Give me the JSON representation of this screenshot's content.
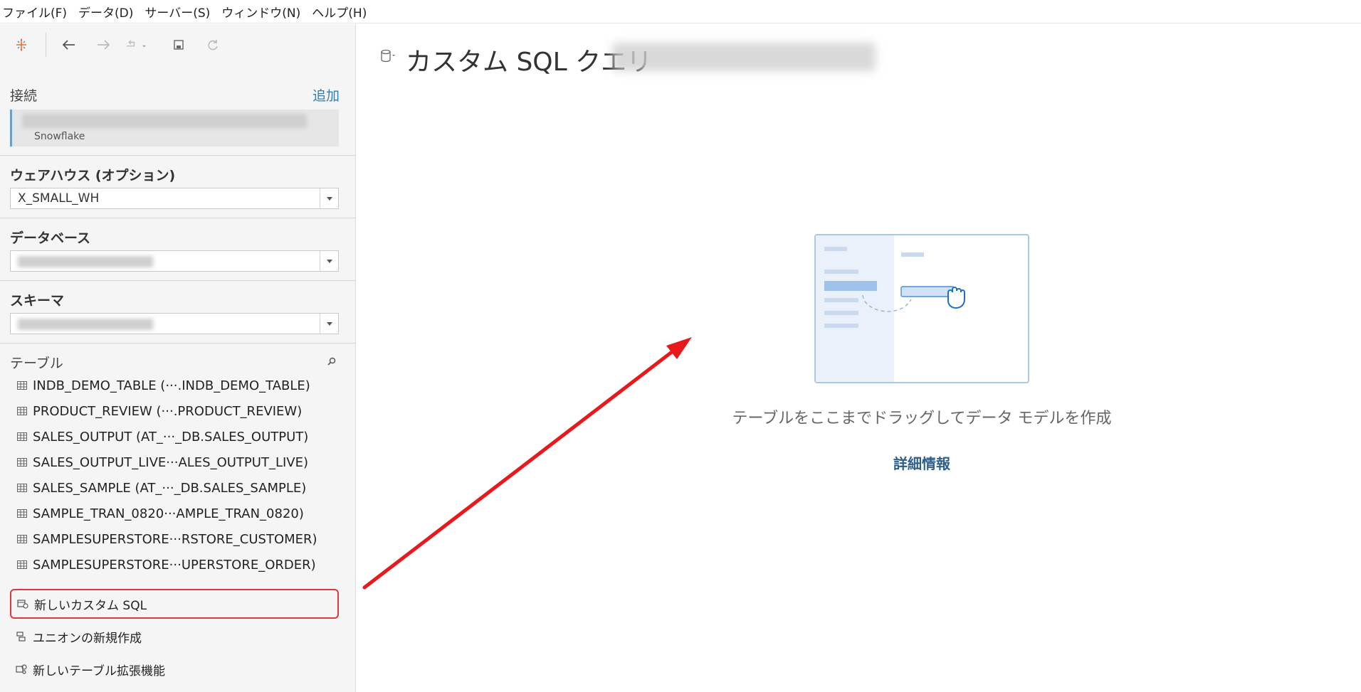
{
  "menu": {
    "file": "ファイル(F)",
    "data": "データ(D)",
    "server": "サーバー(S)",
    "window": "ウィンドウ(N)",
    "help": "ヘルプ(H)"
  },
  "sidebar": {
    "connections_label": "接続",
    "add_label": "追加",
    "connection_type": "Snowflake",
    "warehouse_label": "ウェアハウス (オプション)",
    "warehouse_value": "X_SMALL_WH",
    "database_label": "データベース",
    "schema_label": "スキーマ",
    "tables_label": "テーブル",
    "tables": [
      "INDB_DEMO_TABLE (···.INDB_DEMO_TABLE)",
      "PRODUCT_REVIEW (···.PRODUCT_REVIEW)",
      "SALES_OUTPUT (AT_···_DB.SALES_OUTPUT)",
      "SALES_OUTPUT_LIVE···ALES_OUTPUT_LIVE)",
      "SALES_SAMPLE (AT_···_DB.SALES_SAMPLE)",
      "SAMPLE_TRAN_0820···AMPLE_TRAN_0820)",
      "SAMPLESUPERSTORE···RSTORE_CUSTOMER)",
      "SAMPLESUPERSTORE···UPERSTORE_ORDER)"
    ],
    "new_custom_sql": "新しいカスタム SQL",
    "new_union": "ユニオンの新規作成",
    "new_table_extension": "新しいテーブル拡張機能"
  },
  "canvas": {
    "title": "カスタム SQL クエリ",
    "drop_message": "テーブルをここまでドラッグしてデータ モデルを作成",
    "more_info": "詳細情報"
  },
  "colors": {
    "accent": "#2f80b8",
    "highlight": "#e0383c",
    "arrow": "#e8191c"
  }
}
